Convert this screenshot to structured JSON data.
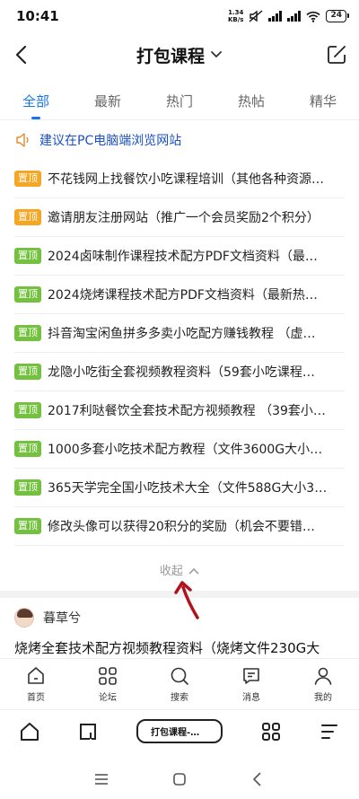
{
  "status_bar": {
    "time": "10:41",
    "net_speed_value": "1.34",
    "net_speed_unit": "KB/s",
    "battery": "24"
  },
  "header": {
    "title": "打包课程",
    "icons": {
      "back": "back-arrow-icon",
      "edit": "compose-icon",
      "dropdown": "chevron-down-icon"
    }
  },
  "tabs": [
    {
      "label": "全部",
      "active": true
    },
    {
      "label": "最新"
    },
    {
      "label": "热门"
    },
    {
      "label": "热帖"
    },
    {
      "label": "精华"
    }
  ],
  "notice": {
    "icon": "speaker-icon",
    "text": "建议在PC电脑端浏览网站"
  },
  "threads": [
    {
      "badge": "置顶",
      "badge_color": "#f5a623",
      "title": "不花钱网上找餐饮小吃课程培训（其他各种资源…"
    },
    {
      "badge": "置顶",
      "badge_color": "#f5a623",
      "title": "邀请朋友注册网站（推广一个会员奖励2个积分）"
    },
    {
      "badge": "置顶",
      "badge_color": "#73c13e",
      "title": "2024卤味制作课程技术配方PDF文档资料（最…"
    },
    {
      "badge": "置顶",
      "badge_color": "#73c13e",
      "title": "2024烧烤课程技术配方PDF文档资料（最新热…"
    },
    {
      "badge": "置顶",
      "badge_color": "#73c13e",
      "title": "抖音淘宝闲鱼拼多多卖小吃配方赚钱教程 （虚…"
    },
    {
      "badge": "置顶",
      "badge_color": "#73c13e",
      "title": "龙隐小吃街全套视频教程资料（59套小吃课程…"
    },
    {
      "badge": "置顶",
      "badge_color": "#73c13e",
      "title": "2017利哒餐饮全套技术配方视频教程 （39套小…"
    },
    {
      "badge": "置顶",
      "badge_color": "#73c13e",
      "title": "1000多套小吃技术配方教程（文件3600G大小…"
    },
    {
      "badge": "置顶",
      "badge_color": "#73c13e",
      "title": "365天学完全国小吃技术大全（文件588G大小3…"
    },
    {
      "badge": "置顶",
      "badge_color": "#73c13e",
      "title": "修改头像可以获得20积分的奖励（机会不要错…"
    }
  ],
  "collapse_label": "收起",
  "post": {
    "author": "暮草兮",
    "title": "烧烤全套技术配方视频教程资料（烧烤文件230G大"
  },
  "bottom_nav": [
    {
      "label": "首页",
      "icon": "home-icon"
    },
    {
      "label": "论坛",
      "icon": "grid-icon"
    },
    {
      "label": "搜索",
      "icon": "search-icon"
    },
    {
      "label": "消息",
      "icon": "message-icon"
    },
    {
      "label": "我的",
      "icon": "user-icon"
    }
  ],
  "browser_bar": {
    "tab_label": "打包课程-北..."
  },
  "colors": {
    "accent": "#1677e8",
    "notice": "#1a4fc6",
    "badge_orange": "#f5a623",
    "badge_green": "#73c13e",
    "arrow": "#b0121b"
  }
}
